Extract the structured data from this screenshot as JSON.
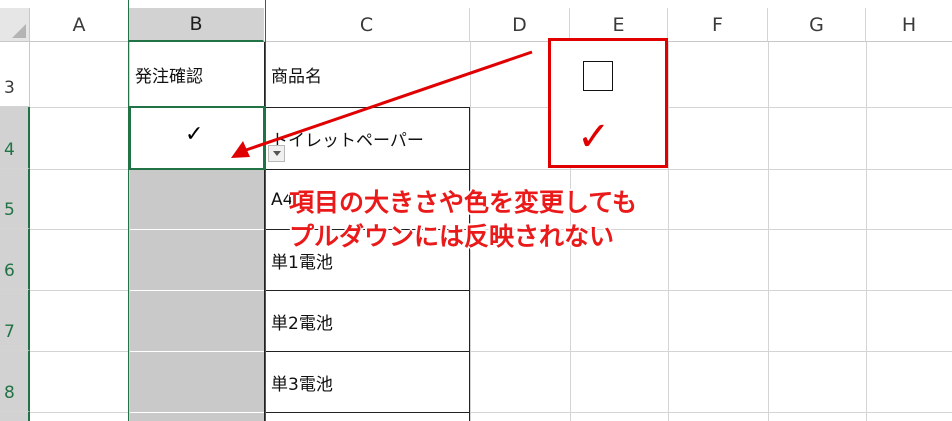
{
  "columns": [
    "A",
    "B",
    "C",
    "D",
    "E",
    "F",
    "G",
    "H"
  ],
  "rows": [
    "3",
    "4",
    "5",
    "6",
    "7",
    "8"
  ],
  "cells": {
    "b3": "発注確認",
    "c3": "商品名",
    "b4_value": "✓",
    "c4": "トイレットペーパー",
    "c5": "A4",
    "c6": "単1電池",
    "c7": "単2電池",
    "c8": "単3電池"
  },
  "legend": {
    "empty_box_icon": "checkbox-empty-icon",
    "red_check": "✓"
  },
  "annotation": {
    "line1": "項目の大きさや色を変更しても",
    "line2": "プルダウンには反映されない"
  },
  "colors": {
    "accent_green": "#217346",
    "annotation_red": "#e00000"
  }
}
